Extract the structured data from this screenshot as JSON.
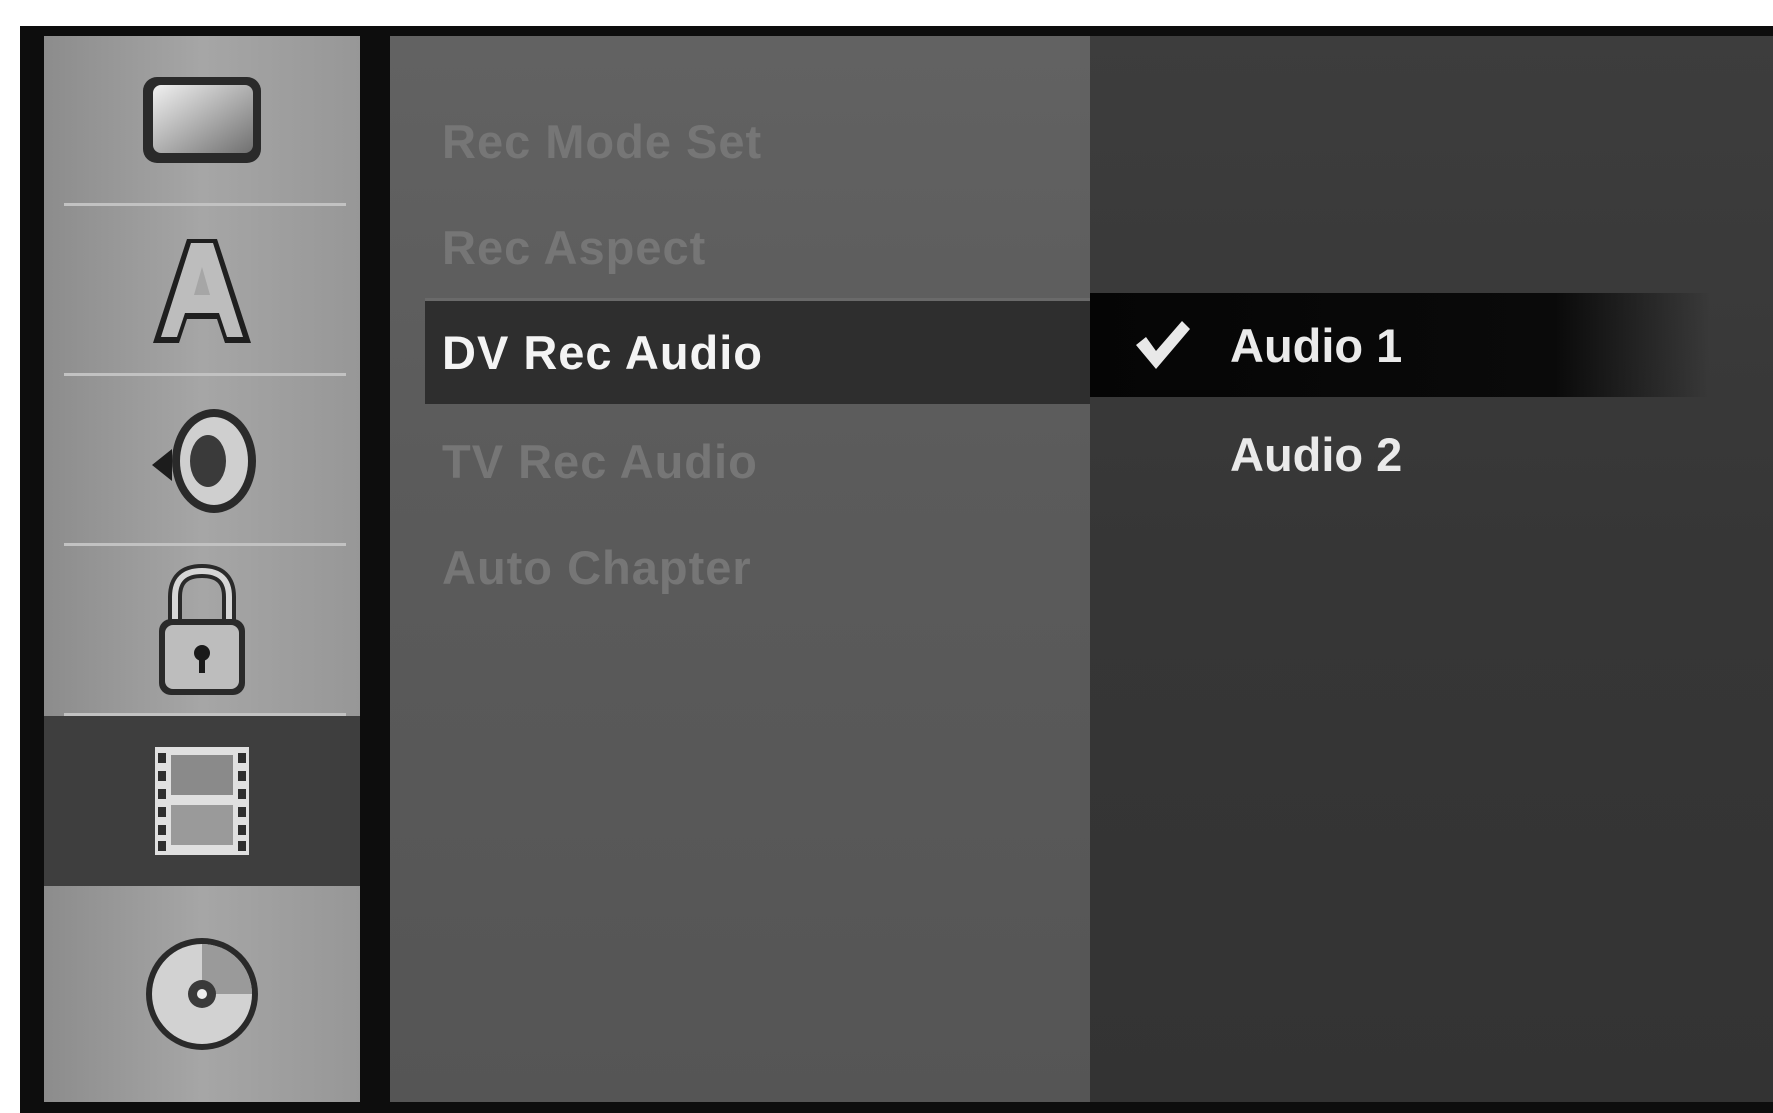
{
  "sidebar": {
    "items": [
      {
        "icon": "tv-screen-icon",
        "active": false
      },
      {
        "icon": "language-a-icon",
        "active": false
      },
      {
        "icon": "speaker-icon",
        "active": false
      },
      {
        "icon": "lock-icon",
        "active": false
      },
      {
        "icon": "film-strip-icon",
        "active": true
      },
      {
        "icon": "disc-icon",
        "active": false
      }
    ]
  },
  "menu": {
    "items": [
      {
        "label": "Rec Mode Set",
        "active": false
      },
      {
        "label": "Rec Aspect",
        "active": false
      },
      {
        "label": "DV Rec Audio",
        "active": true
      },
      {
        "label": "TV Rec Audio",
        "active": false
      },
      {
        "label": "Auto Chapter",
        "active": false
      }
    ]
  },
  "options": {
    "items": [
      {
        "label": "Audio 1",
        "selected": true,
        "checked": true
      },
      {
        "label": "Audio 2",
        "selected": false,
        "checked": false
      }
    ],
    "check_icon": "checkmark-icon"
  },
  "colors": {
    "highlight": "#2e2e2e",
    "selected_option": "#050505",
    "dim_text": "#767676",
    "bright_text": "#f4f4f4"
  }
}
